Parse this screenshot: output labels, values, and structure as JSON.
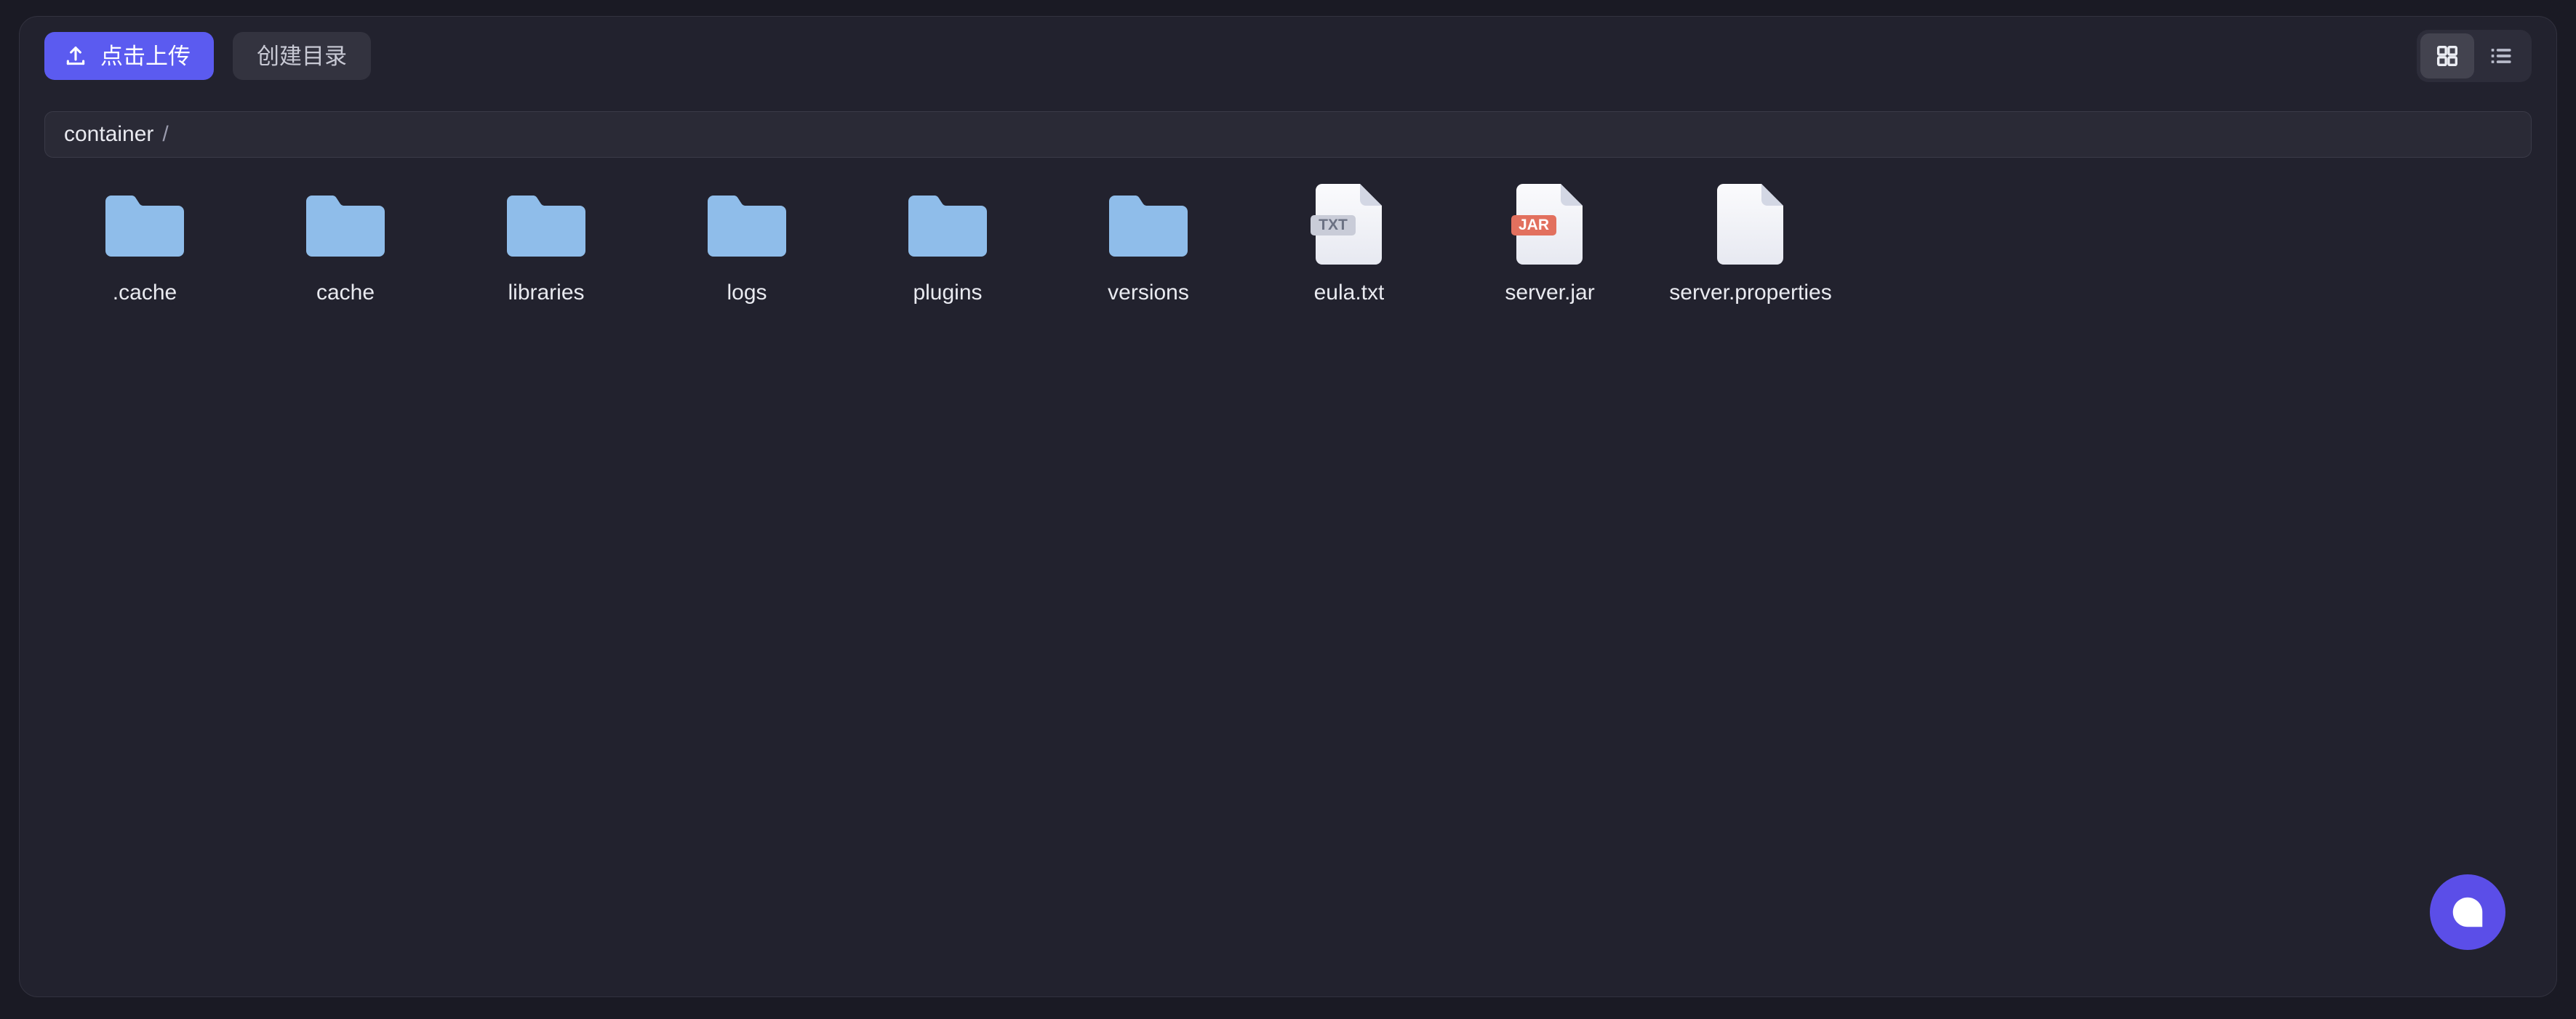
{
  "theme": {
    "page_bg": "#1a1a24",
    "panel_bg": "#22222e",
    "panel_border": "#32323f",
    "accent": "#5b5bf0",
    "secondary_btn_bg": "#33333f",
    "text": "#e9eaf0",
    "muted_text": "#9a9bad",
    "folder_color": "#8fbdea",
    "file_color": "#f2f3f7",
    "jar_badge": "#e2705e",
    "txt_badge": "#c9ccd8",
    "chat_fab": "#5b4ee8"
  },
  "toolbar": {
    "upload_label": "点击上传",
    "upload_icon": "upload-icon",
    "mkdir_label": "创建目录",
    "view_modes": [
      {
        "name": "grid",
        "icon": "grid-view-icon",
        "active": true
      },
      {
        "name": "list",
        "icon": "list-view-icon",
        "active": false
      }
    ]
  },
  "breadcrumb": {
    "root_label": "container",
    "separator": "/"
  },
  "files": [
    {
      "name": ".cache",
      "type": "folder",
      "icon": "folder-icon",
      "badge": ""
    },
    {
      "name": "cache",
      "type": "folder",
      "icon": "folder-icon",
      "badge": ""
    },
    {
      "name": "libraries",
      "type": "folder",
      "icon": "folder-icon",
      "badge": ""
    },
    {
      "name": "logs",
      "type": "folder",
      "icon": "folder-icon",
      "badge": ""
    },
    {
      "name": "plugins",
      "type": "folder",
      "icon": "folder-icon",
      "badge": ""
    },
    {
      "name": "versions",
      "type": "folder",
      "icon": "folder-icon",
      "badge": ""
    },
    {
      "name": "eula.txt",
      "type": "file",
      "icon": "file-txt-icon",
      "badge": "TXT"
    },
    {
      "name": "server.jar",
      "type": "file",
      "icon": "file-jar-icon",
      "badge": "JAR"
    },
    {
      "name": "server.properties",
      "type": "file",
      "icon": "file-blank-icon",
      "badge": ""
    }
  ],
  "chat": {
    "icon": "chat-bubble-icon",
    "label": ""
  }
}
